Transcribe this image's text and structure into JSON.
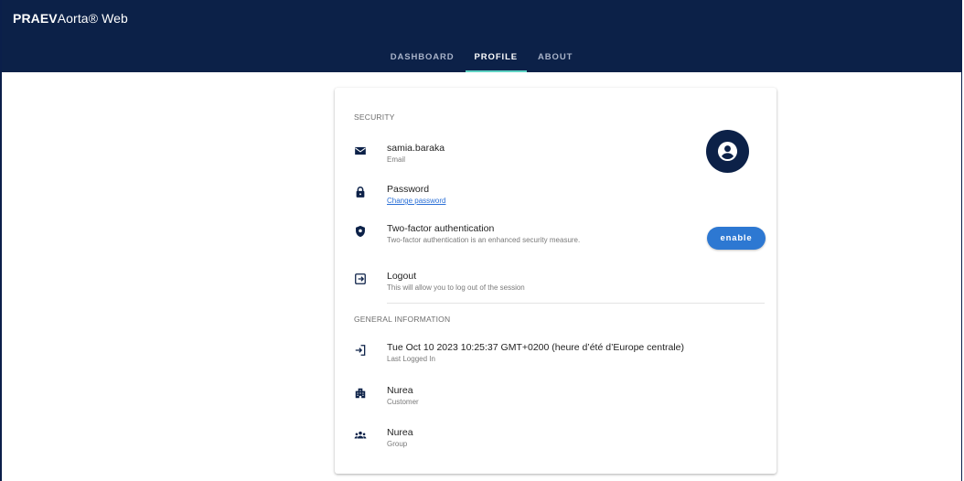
{
  "app": {
    "brand_bold": "PRAEV",
    "brand_rest": "Aorta® Web"
  },
  "nav": {
    "tabs": [
      {
        "label": "DASHBOARD",
        "active": false
      },
      {
        "label": "PROFILE",
        "active": true
      },
      {
        "label": "ABOUT",
        "active": false
      }
    ]
  },
  "colors": {
    "appbar": "#0c2148",
    "tab_indicator": "#5fd3c4",
    "button": "#2d78d2",
    "link": "#2a6fd6"
  },
  "security": {
    "title": "SECURITY",
    "email": {
      "primary": "samia.baraka",
      "secondary": "Email",
      "icon": "email-icon"
    },
    "password": {
      "primary": "Password",
      "link": "Change password",
      "icon": "lock-icon"
    },
    "two_factor": {
      "primary": "Two-factor authentication",
      "secondary": "Two-factor authentication is an enhanced security measure.",
      "icon": "shield-icon",
      "button_label": "enable"
    },
    "logout": {
      "primary": "Logout",
      "secondary": "This will allow you to log out of the session",
      "icon": "logout-icon"
    },
    "avatar_icon": "account-circle-icon"
  },
  "general": {
    "title": "GENERAL INFORMATION",
    "last_login": {
      "primary": "Tue Oct 10 2023 10:25:37 GMT+0200 (heure d’été d’Europe centrale)",
      "secondary": "Last Logged In",
      "icon": "login-icon"
    },
    "customer": {
      "primary": "Nurea",
      "secondary": "Customer",
      "icon": "building-icon"
    },
    "group": {
      "primary": "Nurea",
      "secondary": "Group",
      "icon": "group-icon"
    }
  }
}
